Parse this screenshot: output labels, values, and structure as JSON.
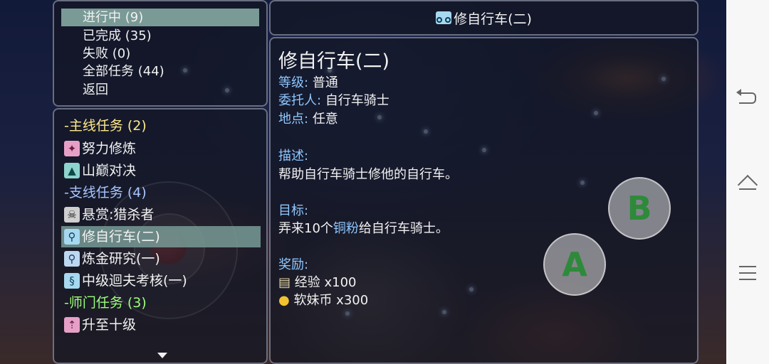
{
  "menu": {
    "items": [
      {
        "label": "进行中 (9)"
      },
      {
        "label": "已完成 (35)"
      },
      {
        "label": "失败 (0)"
      },
      {
        "label": "全部任务 (44)"
      },
      {
        "label": "返回"
      }
    ]
  },
  "quest_list": {
    "main_category": "-主线任务 (2)",
    "main_items": [
      {
        "label": "努力修炼",
        "icon": "training-icon"
      },
      {
        "label": "山巅对决",
        "icon": "mountain-duel-icon"
      }
    ],
    "side_category": "-支线任务 (4)",
    "side_items": [
      {
        "label": "悬赏:猎杀者",
        "icon": "skull-icon"
      },
      {
        "label": "修自行车(二)",
        "icon": "bicycle-icon"
      },
      {
        "label": "炼金研究(一)",
        "icon": "magnifier-icon"
      },
      {
        "label": "中级迴夫考核(一)",
        "icon": "swirl-icon"
      }
    ],
    "master_category": "-师门任务 (3)",
    "master_items": [
      {
        "label": "升至十级",
        "icon": "level-up-icon"
      }
    ]
  },
  "header": {
    "title": "修自行车(二)",
    "icon": "bicycle-icon"
  },
  "detail": {
    "title": "修自行车(二)",
    "level_label": "等级:",
    "level_value": "普通",
    "client_label": "委托人:",
    "client_value": "自行车骑士",
    "location_label": "地点:",
    "location_value": "任意",
    "desc_label": "描述:",
    "desc_value": "帮助自行车骑士修他的自行车。",
    "goal_label": "目标:",
    "goal_prefix": "弄来10个",
    "goal_item": "铜粉",
    "goal_suffix": "给自行车骑士。",
    "reward_label": "奖励:",
    "rewards": [
      {
        "icon": "scroll-icon",
        "text": "经验 x100"
      },
      {
        "icon": "coin-icon",
        "text": "软妹币 x300"
      }
    ]
  },
  "controls": {
    "button_a": "A",
    "button_b": "B"
  },
  "colors": {
    "selected_row": "#7a9a96",
    "main_category": "#ffe98a",
    "side_category": "#a8c6ff",
    "master_category": "#9cff7a",
    "detail_label": "#8ec8ff",
    "button_letter": "#2e8a3a"
  }
}
